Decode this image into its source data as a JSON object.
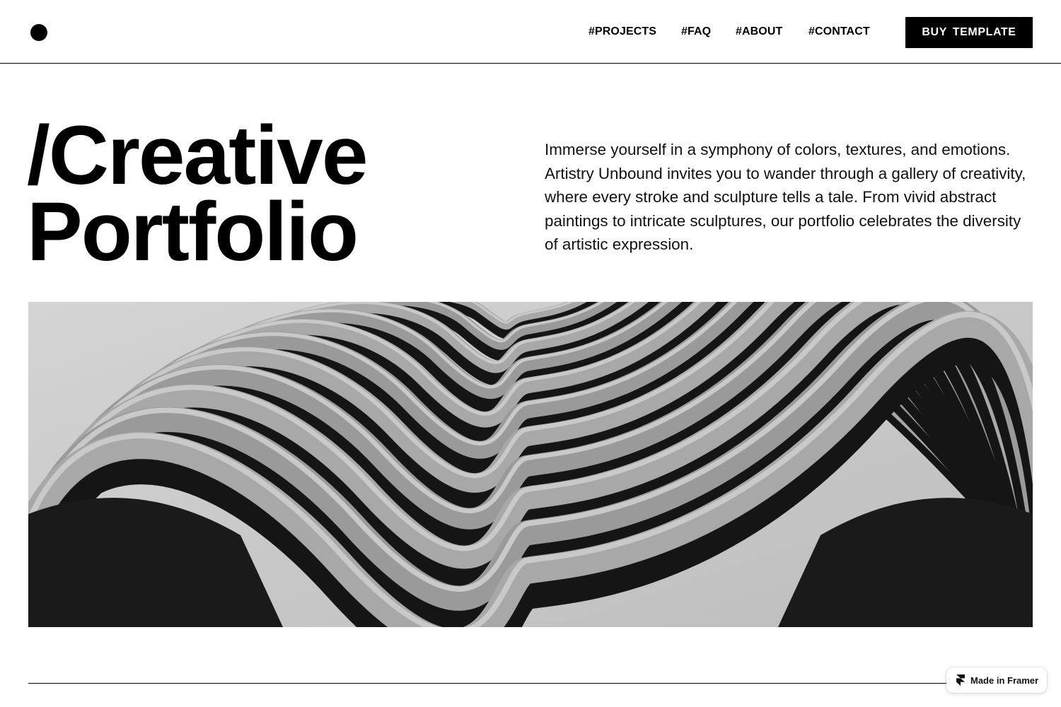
{
  "header": {
    "logo": "circle-logo-icon",
    "nav": [
      {
        "label": "#PROJECTS"
      },
      {
        "label": "#FAQ"
      },
      {
        "label": "#ABOUT"
      },
      {
        "label": "#CONTACT"
      }
    ],
    "cta_label": "BUY  TEMPLATE"
  },
  "hero": {
    "title_line1": "/Creative",
    "title_line2": "Portfolio",
    "description": "Immerse yourself in a symphony of colors, textures, and emotions. Artistry Unbound invites you to wander through a gallery of creativity, where every stroke and sculpture tells a tale. From vivid abstract paintings to intricate sculptures, our portfolio celebrates the diversity of artistic expression."
  },
  "image": {
    "subject": "black-and-white wavy balcony building facade"
  },
  "badge": {
    "icon": "framer-logo-icon",
    "label": "Made in Framer"
  },
  "colors": {
    "background": "#ffffff",
    "text": "#000000",
    "button_bg": "#000000",
    "button_text": "#ffffff"
  }
}
